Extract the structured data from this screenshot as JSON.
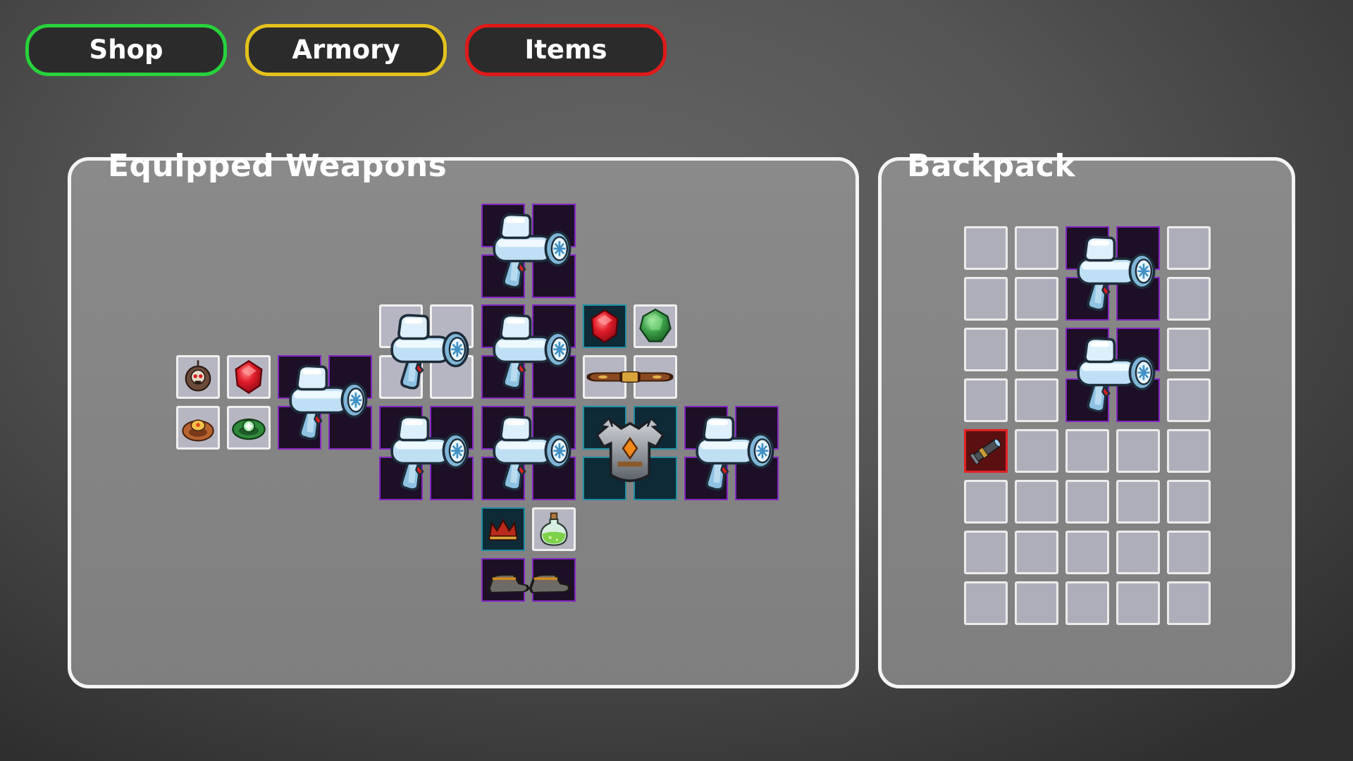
{
  "tabs": {
    "shop": "Shop",
    "armory": "Armory",
    "items": "Items"
  },
  "equipped_panel": {
    "title": "Equipped Weapons",
    "weapons": [
      {
        "name": "freeze-ray-gun",
        "rarity": "epic",
        "slot_size": "2x2"
      },
      {
        "name": "freeze-ray-gun",
        "rarity": "epic",
        "slot_size": "2x2"
      },
      {
        "name": "freeze-ray-gun",
        "rarity": "common",
        "slot_size": "2x2"
      },
      {
        "name": "freeze-ray-gun",
        "rarity": "epic",
        "slot_size": "2x2"
      },
      {
        "name": "freeze-ray-gun",
        "rarity": "epic",
        "slot_size": "2x2"
      },
      {
        "name": "freeze-ray-gun",
        "rarity": "epic",
        "slot_size": "2x2"
      },
      {
        "name": "freeze-ray-gun",
        "rarity": "epic",
        "slot_size": "2x2"
      }
    ],
    "items": [
      {
        "name": "skull-amulet-icon",
        "rarity": "common"
      },
      {
        "name": "ruby-gem-icon",
        "rarity": "common"
      },
      {
        "name": "fire-ring-icon",
        "rarity": "common"
      },
      {
        "name": "heal-ring-icon",
        "rarity": "common"
      },
      {
        "name": "ruby-gem-icon",
        "rarity": "rare"
      },
      {
        "name": "emerald-gem-icon",
        "rarity": "common"
      },
      {
        "name": "leather-belt-icon",
        "rarity": "common"
      },
      {
        "name": "plate-armor-icon",
        "rarity": "rare"
      },
      {
        "name": "crown-icon",
        "rarity": "rare"
      },
      {
        "name": "potion-icon",
        "rarity": "common"
      },
      {
        "name": "boots-icon",
        "rarity": "epic"
      }
    ]
  },
  "backpack_panel": {
    "title": "Backpack",
    "columns": 5,
    "rows": 8,
    "items": [
      {
        "name": "freeze-ray-gun",
        "rarity": "epic",
        "slot_size": "2x2"
      },
      {
        "name": "freeze-ray-gun",
        "rarity": "epic",
        "slot_size": "2x2"
      },
      {
        "name": "scope-icon",
        "rarity": "legendary"
      }
    ]
  },
  "colors": {
    "shop_outline": "#27d23b",
    "armory_outline": "#e3c21d",
    "items_outline": "#e01919",
    "epic_border": "#8526c4",
    "rare_border": "#1f90a6",
    "legendary_border": "#e22222",
    "empty_slot": "#aeaebb"
  }
}
